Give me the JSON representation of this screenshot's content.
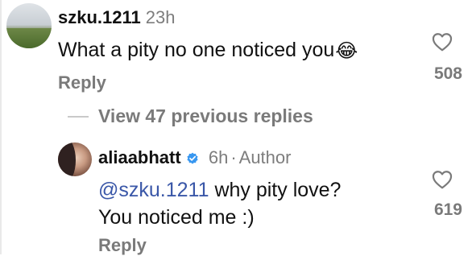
{
  "top_comment": {
    "username": "szku.1211",
    "time": "23h",
    "text": "What a pity no one noticed you",
    "emoji": "😂",
    "reply_label": "Reply",
    "likes": "508"
  },
  "view_replies": {
    "label": "View 47 previous replies"
  },
  "reply_comment": {
    "username": "aliaabhatt",
    "verified": true,
    "time": "6h",
    "separator": "·",
    "role": "Author",
    "mention": "@szku.1211",
    "text_line1": " why pity love?",
    "text_line2": "You noticed me :)",
    "reply_label": "Reply",
    "likes": "619"
  },
  "icons": {
    "like": "heart-outline-icon",
    "verified": "verified-badge-icon"
  },
  "colors": {
    "muted": "#7a7a7a",
    "mention": "#3a57a8",
    "verified": "#3897f0"
  }
}
